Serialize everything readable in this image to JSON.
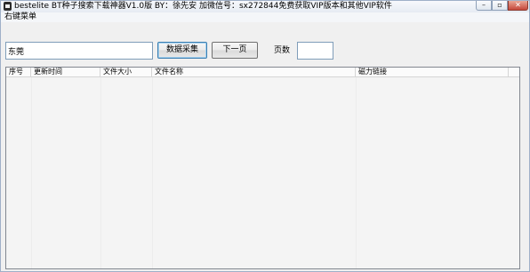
{
  "window": {
    "title": "bestelite BT种子搜索下载神器V1.0版  BY：徐先安   加微信号：sx272844免费获取VIP版本和其他VIP软件",
    "min_symbol": "–",
    "max_symbol": "▫",
    "close_symbol": "✕"
  },
  "menu": {
    "context_menu_label": "右键菜单"
  },
  "toolbar": {
    "search_value": "东莞",
    "collect_label": "数据采集",
    "next_page_label": "下一页",
    "pages_label": "页数",
    "pages_value": ""
  },
  "table": {
    "columns": [
      "序号",
      "更新时间",
      "文件大小",
      "文件名称",
      "磁力链接",
      ""
    ],
    "rows": []
  },
  "colors": {
    "window_bg": "#f0f0f0",
    "list_bg": "#f4f4f4",
    "input_border": "#7f9db9",
    "close_button": "#c5473a"
  }
}
